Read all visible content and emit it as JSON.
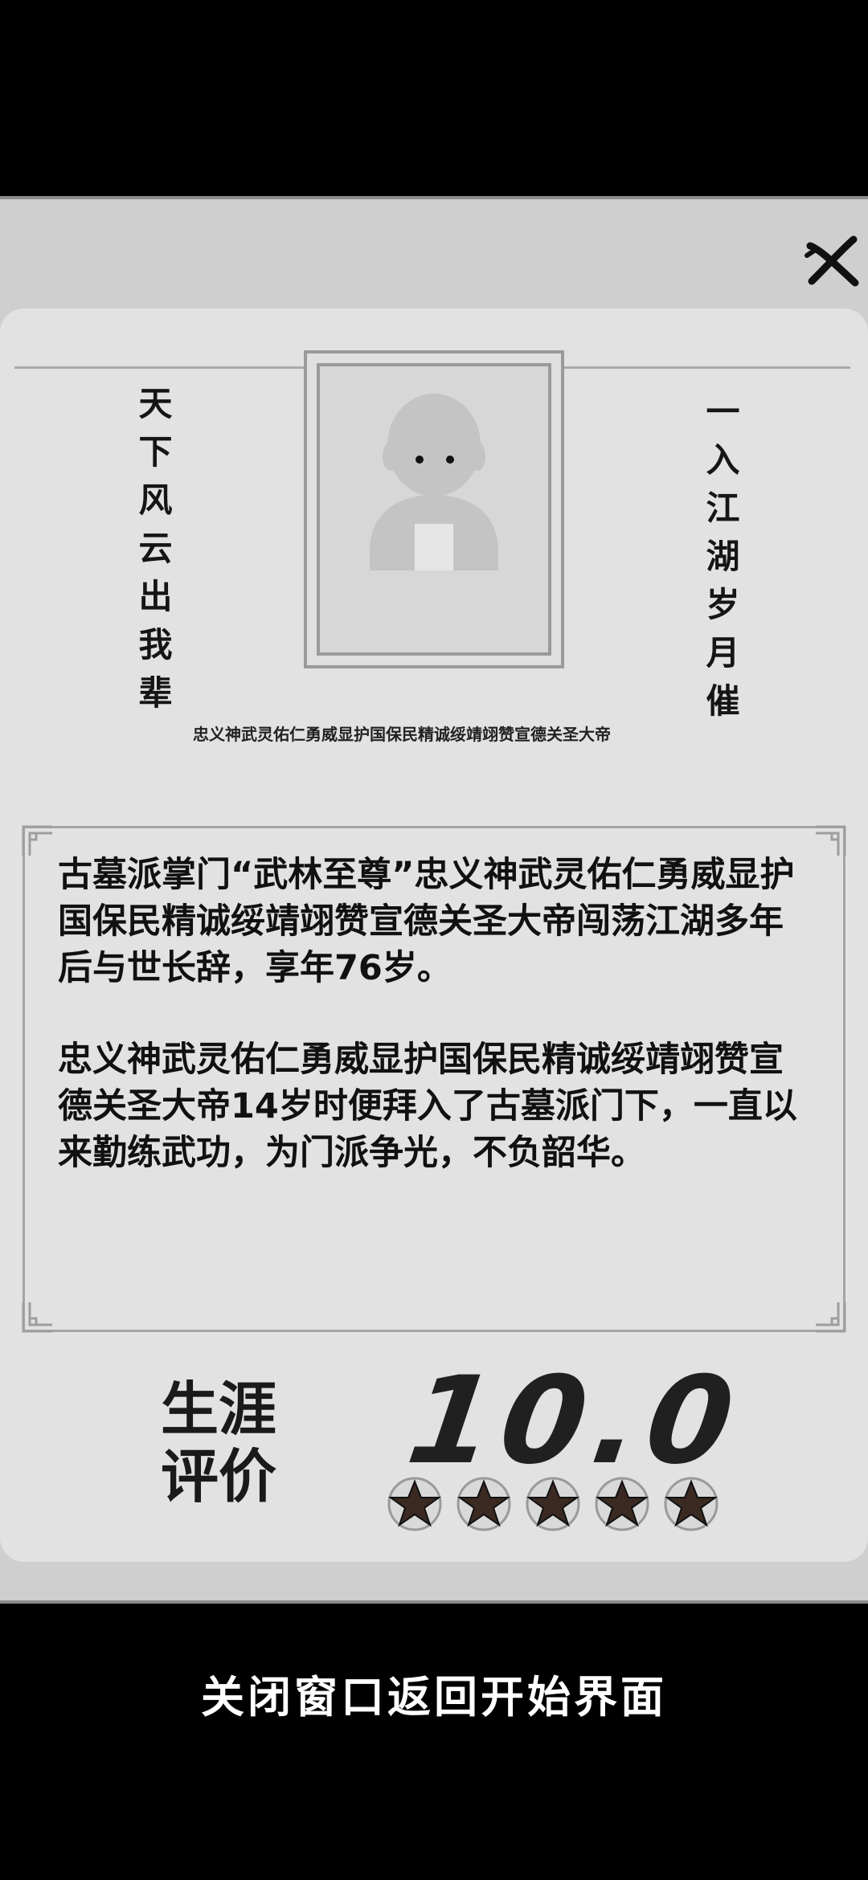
{
  "motto_left": "天下风云出我辈",
  "motto_right": "一入江湖岁月催",
  "full_title": "忠义神武灵佑仁勇威显护国保民精诚绥靖翊赞宣德关圣大帝",
  "bio": {
    "paragraph1": "古墓派掌门“武林至尊”忠义神武灵佑仁勇威显护国保民精诚绥靖翊赞宣德关圣大帝闯荡江湖多年后与世长辞，享年76岁。",
    "paragraph2": "忠义神武灵佑仁勇威显护国保民精诚绥靖翊赞宣德关圣大帝14岁时便拜入了古墓派门下，一直以来勤练武功，为门派争光，不负韶华。"
  },
  "career": {
    "label_line1": "生涯",
    "label_line2": "评价",
    "score": "10.0",
    "stars": 5
  },
  "footer_text": "关闭窗口返回开始界面",
  "icons": {
    "close": "close-icon",
    "avatar": "avatar-placeholder",
    "star": "star-icon"
  }
}
